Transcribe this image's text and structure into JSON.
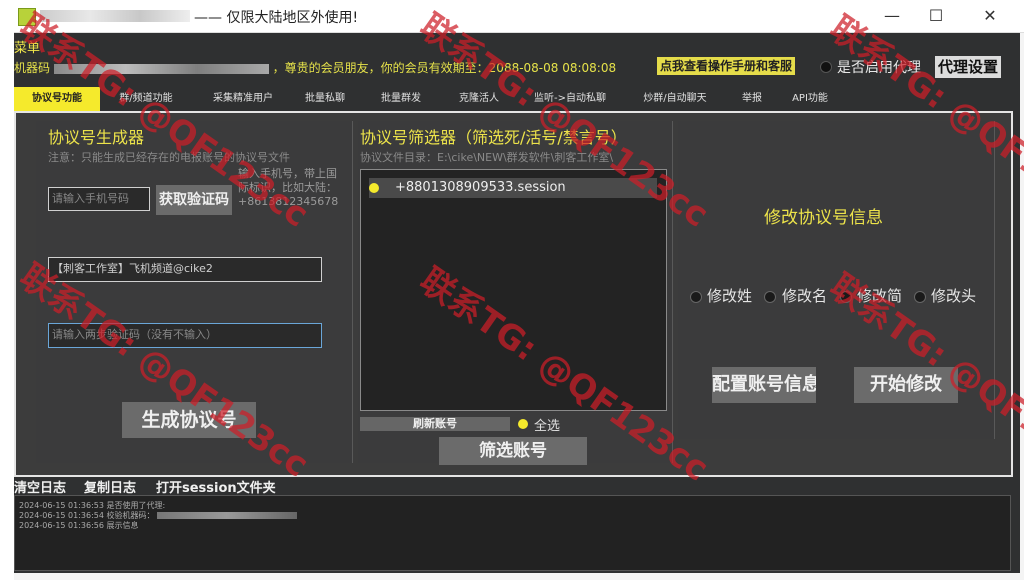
{
  "window": {
    "title": "—— 仅限大陆地区外使用!",
    "minimize": "—",
    "maximize": "☐",
    "close": "✕"
  },
  "header": {
    "menu": "菜单",
    "machine_label": "机器码",
    "membership_text": "，尊贵的会员朋友，你的会员有效期至：2088-08-08 08:08:08",
    "help_button": "点我查看操作手册和客服",
    "proxy_label": "是否启用代理",
    "proxy_settings": "代理设置"
  },
  "tabs": [
    "协议号功能",
    "群/频道功能",
    "采集精准用户",
    "批量私聊",
    "批量群发",
    "克隆活人",
    "监听->自动私聊",
    "炒群/自动聊天",
    "举报",
    "API功能"
  ],
  "generator": {
    "title": "协议号生成器",
    "note": "注意：只能生成已经存在的电报账号的协议号文件",
    "phone_placeholder": "请输入手机号码",
    "get_code": "获取验证码",
    "phone_hint": "输入手机号，带上国际标识，比如大陆：+8613812345678",
    "studio_text": "【刺客工作室】飞机频道@cike2",
    "twofa_placeholder": "请输入两步验证码（没有不输入）",
    "generate": "生成协议号"
  },
  "filter": {
    "title": "协议号筛选器（筛选死/活号/禁言号）",
    "dir": "协议文件目录：E:\\cike\\NEW\\群发软件\\刺客工作室\\",
    "items": [
      "+8801308909533.session"
    ],
    "refresh": "刷新账号",
    "select_all": "全选",
    "filter_btn": "筛选账号"
  },
  "modify": {
    "title": "修改协议号信息",
    "options": [
      "修改姓",
      "修改名",
      "修改简",
      "修改头"
    ],
    "config": "配置账号信息",
    "start": "开始修改"
  },
  "log": {
    "clear": "清空日志",
    "copy": "复制日志",
    "open_folder": "打开session文件夹",
    "lines": [
      "2024-06-15 01:36:53 是否使用了代理:",
      "2024-06-15 01:36:54 校验机器码：",
      "2024-06-15 01:36:56 展示信息"
    ]
  },
  "watermark": "联系TG: @QF123cc",
  "colors": {
    "accent": "#f5ea2c",
    "bg": "#2f3031",
    "watermark": "#cd1e28"
  }
}
